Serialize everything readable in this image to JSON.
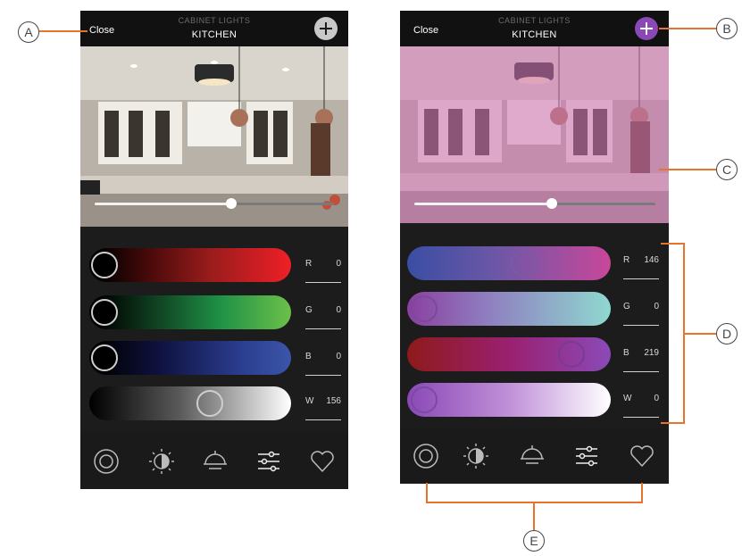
{
  "left_screen": {
    "close_label": "Close",
    "subtitle": "CABINET LIGHTS",
    "title": "KITCHEN",
    "brightness": 0.57,
    "channels": [
      {
        "label": "R",
        "value": "0"
      },
      {
        "label": "G",
        "value": "0"
      },
      {
        "label": "B",
        "value": "0"
      },
      {
        "label": "W",
        "value": "156"
      }
    ],
    "selected_tab": "sliders"
  },
  "right_screen": {
    "close_label": "Close",
    "subtitle": "CABINET LIGHTS",
    "title": "KITCHEN",
    "brightness": 0.57,
    "channels": [
      {
        "label": "R",
        "value": "146"
      },
      {
        "label": "G",
        "value": "0"
      },
      {
        "label": "B",
        "value": "219"
      },
      {
        "label": "W",
        "value": "0"
      }
    ],
    "selected_tab": "sliders"
  },
  "tabs": [
    "color-wheel-icon",
    "sun-moon-icon",
    "lamp-icon",
    "sliders-icon",
    "heart-icon"
  ],
  "callouts": {
    "a": "A",
    "b": "B",
    "c": "C",
    "d": "D",
    "e": "E"
  },
  "colors": {
    "callout_line": "#e8742c",
    "add_active": "#8a48b6",
    "tint": "#cd70b2"
  }
}
